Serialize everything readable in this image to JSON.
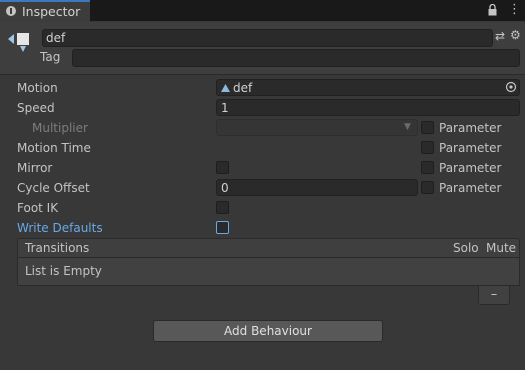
{
  "tab": {
    "label": "Inspector",
    "icon": "info-icon"
  },
  "header_icons": {
    "lock": "lock-icon",
    "menu": "kebab-menu-icon",
    "preset": "preset-icon",
    "settings": "gear-icon"
  },
  "object": {
    "name": "def",
    "tag_label": "Tag",
    "tag_value": ""
  },
  "fields": {
    "motion": {
      "label": "Motion",
      "value": "def",
      "picker_icon": "object-picker-icon"
    },
    "speed": {
      "label": "Speed",
      "value": "1"
    },
    "multiplier": {
      "label": "Multiplier",
      "value": ""
    },
    "motion_time": {
      "label": "Motion Time"
    },
    "mirror": {
      "label": "Mirror"
    },
    "cycle_offset": {
      "label": "Cycle Offset",
      "value": "0"
    },
    "foot_ik": {
      "label": "Foot IK"
    },
    "write_defaults": {
      "label": "Write Defaults"
    }
  },
  "param_label": "Parameter",
  "transitions": {
    "header": "Transitions",
    "solo": "Solo",
    "mute": "Mute",
    "empty_text": "List is Empty",
    "remove_label": "–"
  },
  "add_behaviour_label": "Add Behaviour",
  "colors": {
    "accent": "#3a79bb",
    "link": "#6aa9e7",
    "panel": "#383838"
  }
}
